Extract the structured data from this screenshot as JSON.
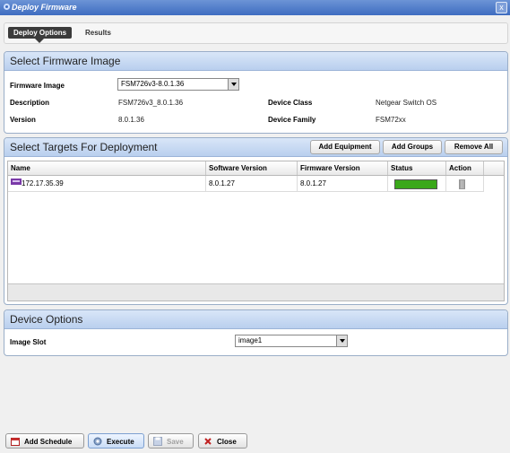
{
  "window": {
    "title": "Deploy Firmware",
    "close_label": "x"
  },
  "tabs": [
    {
      "label": "Deploy Options"
    },
    {
      "label": "Results"
    }
  ],
  "firmware_panel": {
    "title": "Select Firmware Image",
    "firmware_image_label": "Firmware Image",
    "firmware_image_value": "FSM726v3-8.0.1.36",
    "description_label": "Description",
    "description_value": "FSM726v3_8.0.1.36",
    "version_label": "Version",
    "version_value": "8.0.1.36",
    "device_class_label": "Device Class",
    "device_class_value": "Netgear Switch OS",
    "device_family_label": "Device Family",
    "device_family_value": "FSM72xx"
  },
  "targets_panel": {
    "title": "Select Targets For Deployment",
    "add_equipment_label": "Add Equipment",
    "add_groups_label": "Add Groups",
    "remove_all_label": "Remove All",
    "columns": [
      "Name",
      "Software Version",
      "Firmware Version",
      "Status",
      "Action"
    ],
    "rows": [
      {
        "name": "172.17.35.39",
        "software_version": "8.0.1.27",
        "firmware_version": "8.0.1.27",
        "status_progress": 1.0
      }
    ]
  },
  "device_options_panel": {
    "title": "Device Options",
    "image_slot_label": "Image Slot",
    "image_slot_value": "image1"
  },
  "footer": {
    "add_schedule_label": "Add Schedule",
    "execute_label": "Execute",
    "save_label": "Save",
    "close_label": "Close"
  },
  "colors": {
    "status_bar": "#3aa81a",
    "accent": "#3e6cc0"
  },
  "icons": {
    "add_schedule": "calendar-icon",
    "execute": "gear-icon",
    "save": "floppy-icon",
    "close": "x-icon",
    "device": "device-icon",
    "action": "trash-icon"
  }
}
